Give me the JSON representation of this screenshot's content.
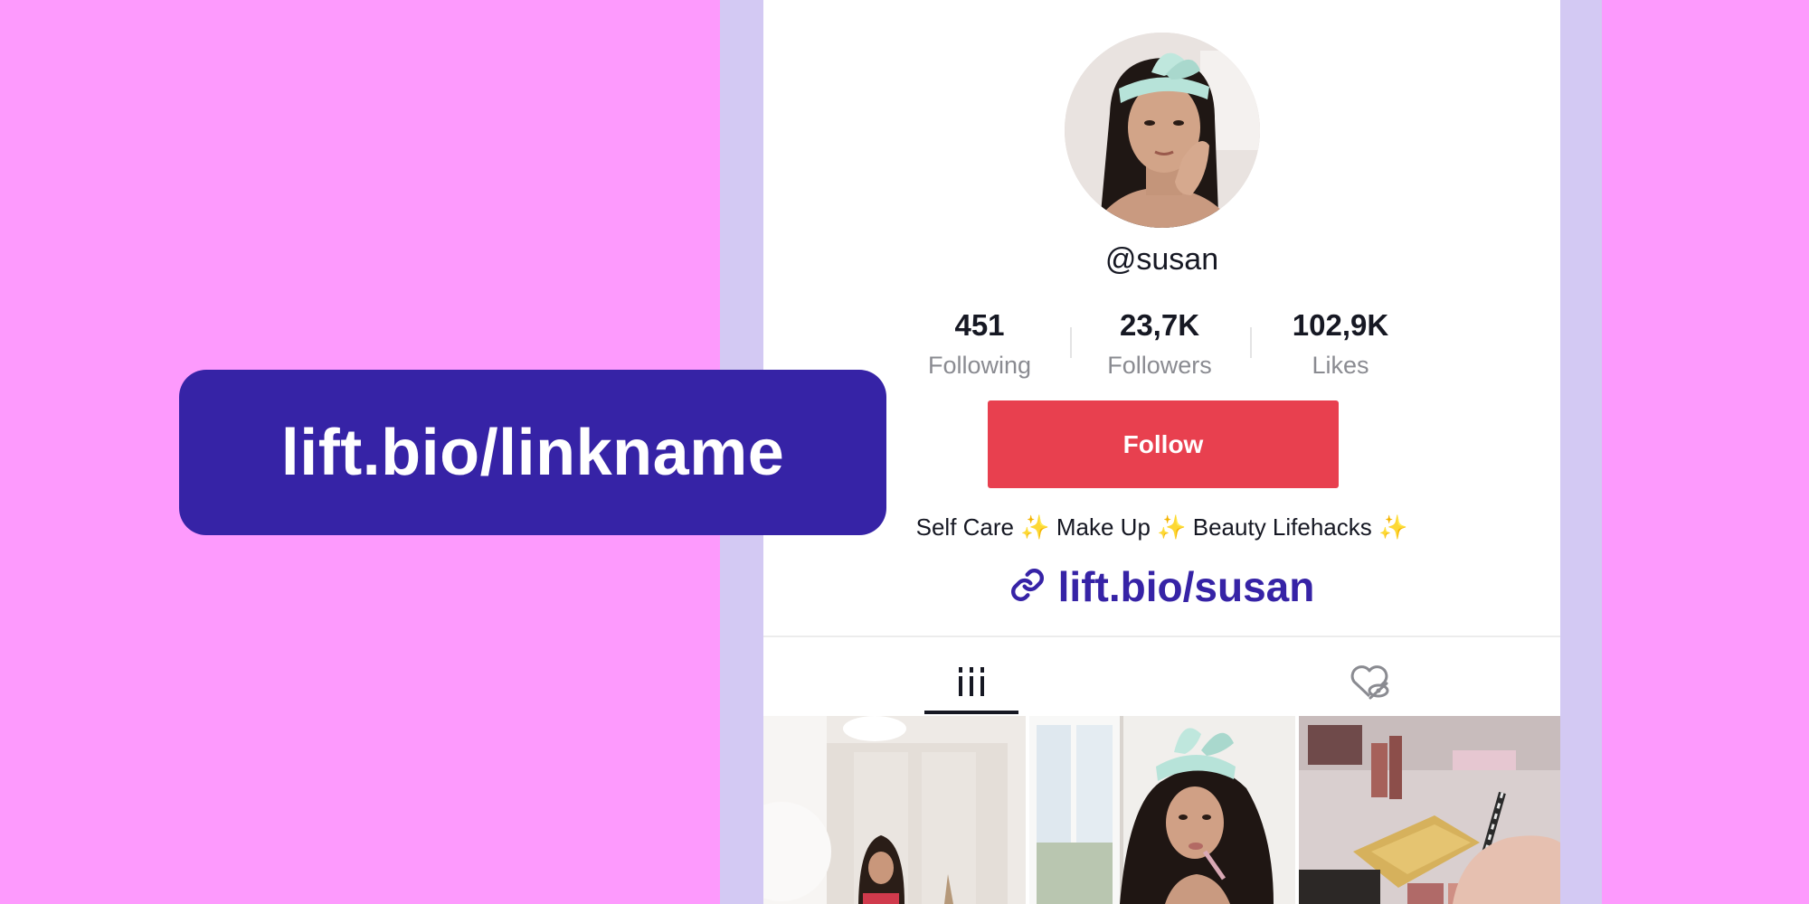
{
  "profile": {
    "username": "@susan",
    "stats": [
      {
        "value": "451",
        "label": "Following"
      },
      {
        "value": "23,7K",
        "label": "Followers"
      },
      {
        "value": "102,9K",
        "label": "Likes"
      }
    ],
    "follow_label": "Follow",
    "bio": {
      "parts": [
        "Self Care",
        "Make Up",
        "Beauty Lifehacks"
      ],
      "separator": "✨"
    },
    "link_text": "lift.bio/susan"
  },
  "tabs": [
    {
      "icon": "grid-icon",
      "selected": true
    },
    {
      "icon": "liked-hidden-icon",
      "selected": false
    }
  ],
  "callout": {
    "text": "lift.bio/linkname"
  },
  "colors": {
    "background": "#fd9afd",
    "frame": "#d3c9f3",
    "accent": "#3623a6",
    "follow": "#e8404f"
  }
}
